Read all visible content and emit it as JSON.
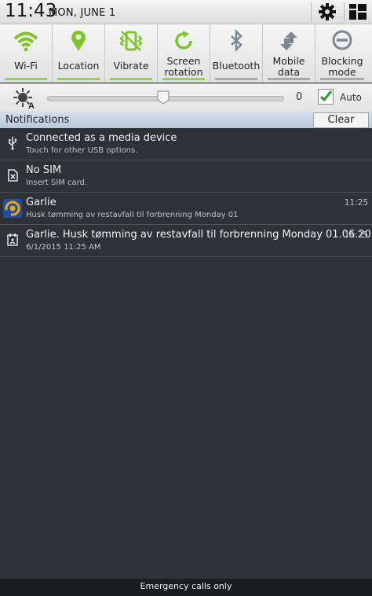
{
  "status_bar": {
    "time": "11:43",
    "date": "MON, JUNE 1",
    "icons": [
      "settings-gear-icon",
      "grid-icon"
    ]
  },
  "quick_settings": [
    {
      "label": "Wi-Fi",
      "icon": "wifi-icon",
      "active": true
    },
    {
      "label": "Location",
      "icon": "location-pin-icon",
      "active": true
    },
    {
      "label": "Vibrate",
      "icon": "vibrate-icon",
      "active": true
    },
    {
      "label": "Screen rotation",
      "icon": "rotation-icon",
      "active": true
    },
    {
      "label": "Bluetooth",
      "icon": "bluetooth-icon",
      "active": false
    },
    {
      "label": "Mobile data",
      "icon": "mobile-data-icon",
      "active": false
    },
    {
      "label": "Blocking mode",
      "icon": "blocking-mode-icon",
      "active": false
    }
  ],
  "brightness": {
    "value": "0",
    "level": 0.5,
    "auto_label": "Auto",
    "auto_checked": true
  },
  "notifications": {
    "header": "Notifications",
    "clear_label": "Clear",
    "items": [
      {
        "icon": "usb-icon",
        "title": "Connected as a media device",
        "subtitle": "Touch for other USB options.",
        "time": ""
      },
      {
        "icon": "no-sim-icon",
        "title": "No SIM",
        "subtitle": "Insert SIM card.",
        "time": ""
      },
      {
        "icon": "garlie-app-icon",
        "title": "Garlie",
        "subtitle": "Husk tømming av restavfall til forbrenning Monday 01",
        "time": "11:25"
      },
      {
        "icon": "calendar-icon",
        "title": "Garlie. Husk tømming av restavfall til forbrenning Monday 01.06.2015",
        "subtitle": "6/1/2015 11:25 AM",
        "time": "11:25"
      }
    ]
  },
  "footer": {
    "emergency": "Emergency calls only"
  },
  "colors": {
    "active_green": "#9bd04a",
    "panel_bg": "#2e3236",
    "header_blue": "#c4d2e2"
  }
}
